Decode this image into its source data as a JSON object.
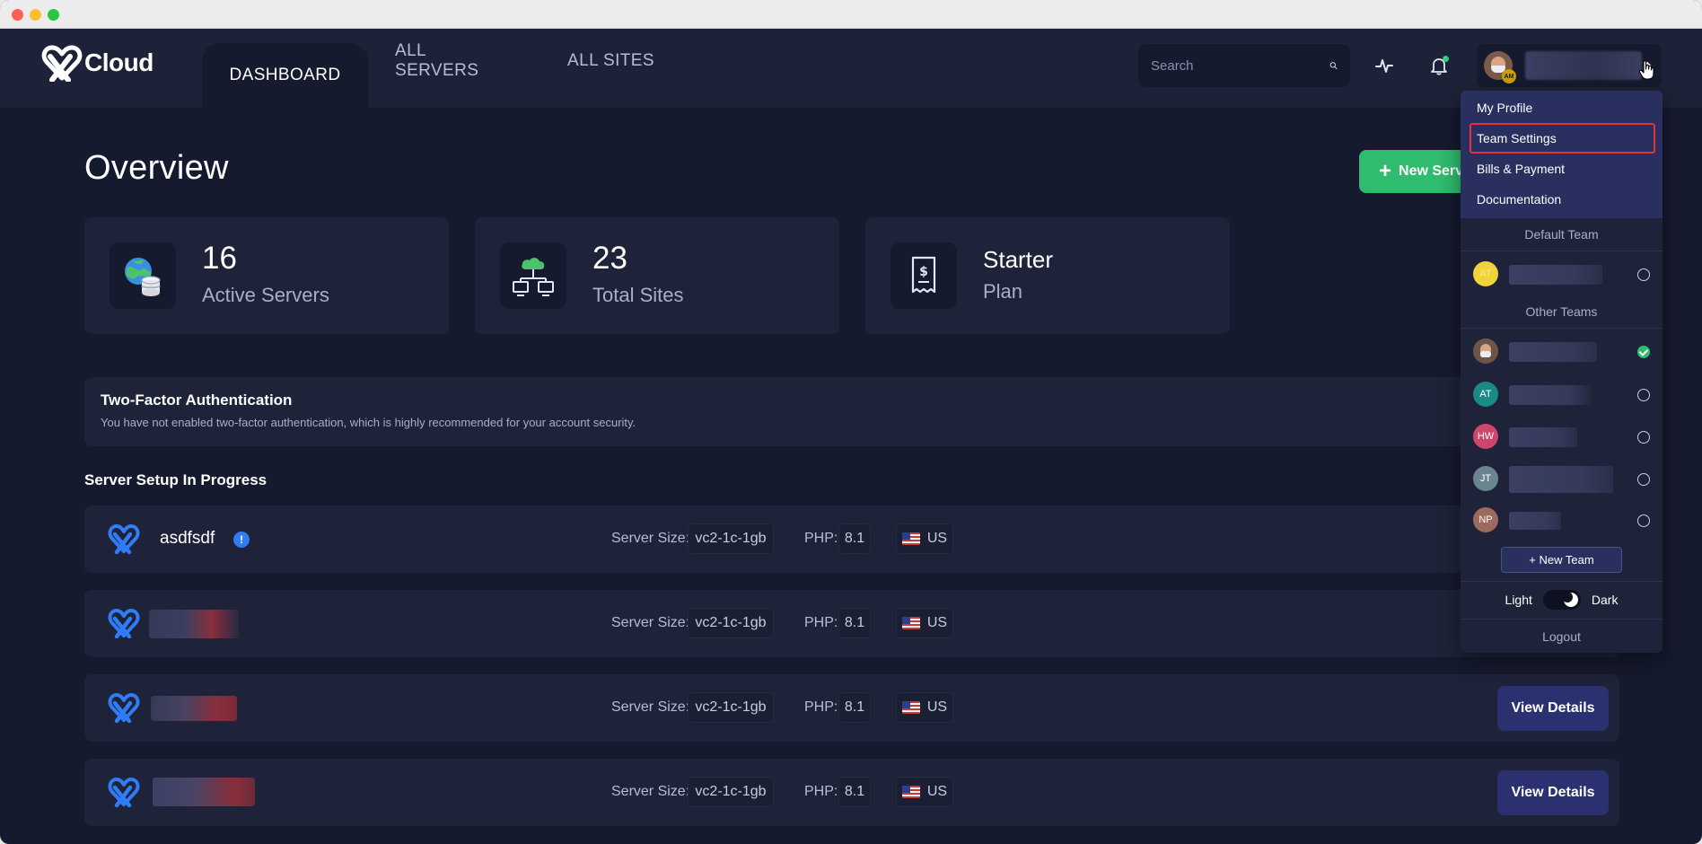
{
  "brand": {
    "name": "Cloud"
  },
  "nav": {
    "tabs": [
      {
        "label": "DASHBOARD"
      },
      {
        "label": "ALL SERVERS"
      },
      {
        "label": "ALL SITES"
      }
    ],
    "search_placeholder": "Search"
  },
  "profile": {
    "badge": "AM"
  },
  "page": {
    "title": "Overview",
    "new_server_label": "New Server"
  },
  "stats": [
    {
      "value": "16",
      "label": "Active Servers"
    },
    {
      "value": "23",
      "label": "Total Sites"
    },
    {
      "value": "Starter",
      "label": "Plan"
    }
  ],
  "tfa": {
    "title": "Two-Factor Authentication",
    "description": "You have not enabled two-factor authentication, which is highly recommended for your account security."
  },
  "servers_section": {
    "title": "Server Setup In Progress"
  },
  "server_meta_labels": {
    "size": "Server Size:",
    "php": "PHP:"
  },
  "servers": [
    {
      "name": "asdfsdf",
      "size": "vc2-1c-1gb",
      "php": "8.1",
      "region": "US",
      "action": ""
    },
    {
      "name": "",
      "size": "vc2-1c-1gb",
      "php": "8.1",
      "region": "US",
      "action": ""
    },
    {
      "name": "",
      "size": "vc2-1c-1gb",
      "php": "8.1",
      "region": "US",
      "action": "View Details"
    },
    {
      "name": "",
      "size": "vc2-1c-1gb",
      "php": "8.1",
      "region": "US",
      "action": "View Details"
    }
  ],
  "dropdown": {
    "items": [
      {
        "label": "My Profile"
      },
      {
        "label": "Team Settings"
      },
      {
        "label": "Bills & Payment"
      },
      {
        "label": "Documentation"
      }
    ],
    "default_team_header": "Default Team",
    "default_team": {
      "initials": "AT",
      "color": "#f2d43a"
    },
    "other_teams_header": "Other Teams",
    "other_teams": [
      {
        "initials": "",
        "selected": true
      },
      {
        "initials": "AT",
        "color": "#1a8a84",
        "selected": false
      },
      {
        "initials": "HW",
        "color": "#d0456c",
        "selected": false
      },
      {
        "initials": "JT",
        "color": "#6b8590",
        "selected": false
      },
      {
        "initials": "NP",
        "color": "#9c6a5f",
        "selected": false
      }
    ],
    "new_team_label": "+ New Team",
    "theme": {
      "light": "Light",
      "dark": "Dark"
    },
    "logout_label": "Logout"
  },
  "colors": {
    "accent_green": "#2fbc6e",
    "highlight_red": "#e0343d",
    "brand_blue": "#2f7cf6"
  }
}
